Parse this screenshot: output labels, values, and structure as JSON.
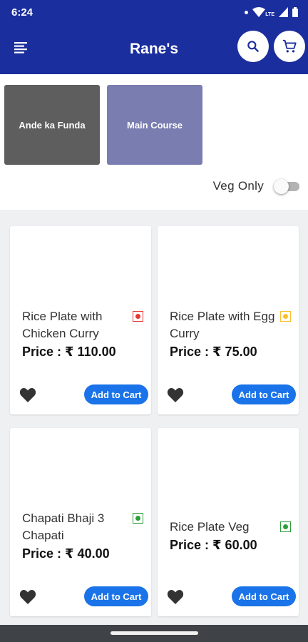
{
  "status_bar": {
    "time": "6:24",
    "network_label": "LTE",
    "icons": [
      "dot-icon",
      "wifi-icon",
      "signal-icon",
      "battery-icon"
    ]
  },
  "app_bar": {
    "title": "Rane's",
    "menu_icon": "menu-icon",
    "search_icon": "search-icon",
    "cart_icon": "cart-icon"
  },
  "categories": [
    {
      "label": "Ande ka Funda",
      "color": "#5e5e5e"
    },
    {
      "label": "Main Course",
      "color": "#7a7db0"
    }
  ],
  "filter": {
    "veg_only_label": "Veg Only",
    "veg_only_on": false
  },
  "products": [
    {
      "title": "Rice Plate with Chicken Curry",
      "price": "Price : ₹ 110.00",
      "badge_color": "#e53935",
      "button_label": "Add to Cart"
    },
    {
      "title": "Rice Plate with Egg Curry",
      "price": "Price : ₹ 75.00",
      "badge_color": "#fbc02d",
      "button_label": "Add to Cart"
    },
    {
      "title": "Chapati Bhaji 3 Chapati",
      "price": "Price : ₹ 40.00",
      "badge_color": "#2e9e3a",
      "button_label": "Add to Cart"
    },
    {
      "title": "Rice Plate Veg",
      "price": "Price : ₹ 60.00",
      "badge_color": "#2e9e3a",
      "button_label": "Add to Cart"
    }
  ],
  "colors": {
    "app_bar": "#1b2e9e",
    "accent_button": "#1a73e8"
  }
}
